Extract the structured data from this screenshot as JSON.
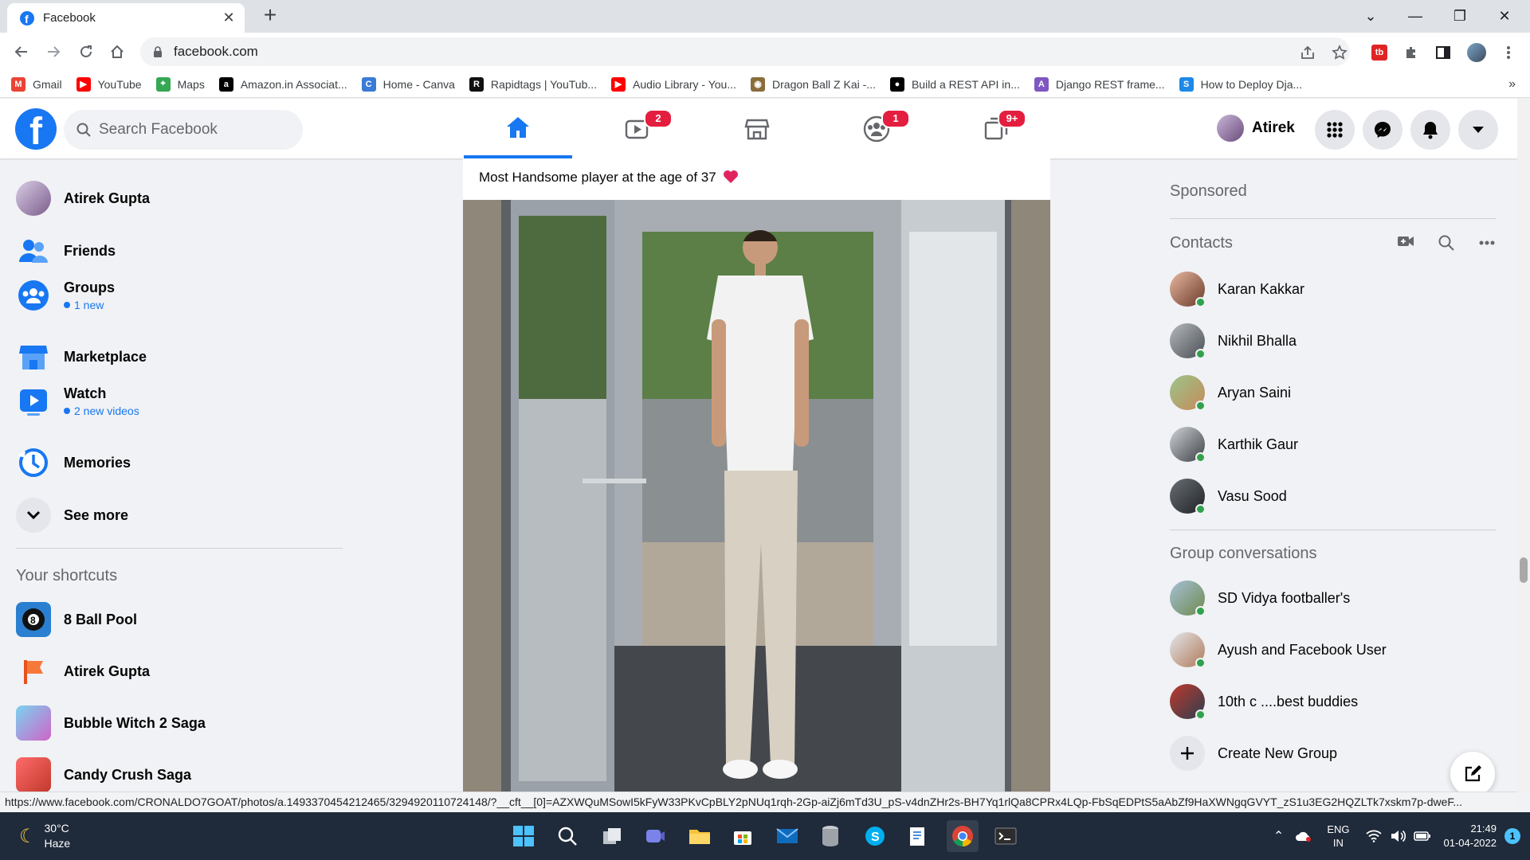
{
  "browser": {
    "tab_title": "Facebook",
    "url": "facebook.com",
    "bookmarks": [
      {
        "label": "Gmail",
        "icon": "gmail-icon",
        "color": "#ea4335",
        "glyph": "M"
      },
      {
        "label": "YouTube",
        "icon": "youtube-icon",
        "color": "#ff0000",
        "glyph": "▶"
      },
      {
        "label": "Maps",
        "icon": "maps-icon",
        "color": "#34a853",
        "glyph": "⌖"
      },
      {
        "label": "Amazon.in Associat...",
        "icon": "amazon-icon",
        "color": "#000000",
        "glyph": "a"
      },
      {
        "label": "Home - Canva",
        "icon": "canva-icon",
        "color": "#3a7bd5",
        "glyph": "C"
      },
      {
        "label": "Rapidtags | YouTub...",
        "icon": "rapidtags-icon",
        "color": "#111111",
        "glyph": "R"
      },
      {
        "label": "Audio Library - You...",
        "icon": "youtube-icon",
        "color": "#ff0000",
        "glyph": "▶"
      },
      {
        "label": "Dragon Ball Z Kai -...",
        "icon": "dragonball-icon",
        "color": "#8a6d3b",
        "glyph": "◉"
      },
      {
        "label": "Build a REST API in...",
        "icon": "medium-icon",
        "color": "#000000",
        "glyph": "●"
      },
      {
        "label": "Django REST frame...",
        "icon": "django-icon",
        "color": "#7e57c2",
        "glyph": "A"
      },
      {
        "label": "How to Deploy Dja...",
        "icon": "s-icon",
        "color": "#1e88e5",
        "glyph": "S"
      }
    ],
    "more_bookmarks": "»"
  },
  "header": {
    "search_placeholder": "Search Facebook",
    "profile_name": "Atirek",
    "badges": {
      "watch": "2",
      "groups": "1",
      "gaming": "9+"
    }
  },
  "left": {
    "items": [
      {
        "label": "Atirek Gupta"
      },
      {
        "label": "Friends"
      },
      {
        "label": "Groups",
        "sub": "1 new"
      },
      {
        "label": "Marketplace"
      },
      {
        "label": "Watch",
        "sub": "2 new videos"
      },
      {
        "label": "Memories"
      },
      {
        "label": "See more"
      }
    ],
    "shortcuts_heading": "Your shortcuts",
    "shortcuts": [
      {
        "label": "8 Ball Pool"
      },
      {
        "label": "Atirek Gupta"
      },
      {
        "label": "Bubble Witch 2 Saga"
      },
      {
        "label": "Candy Crush Saga"
      }
    ]
  },
  "post": {
    "text": "Most Handsome player at the age of 37"
  },
  "right": {
    "sponsored": "Sponsored",
    "contacts_heading": "Contacts",
    "contacts": [
      "Karan Kakkar",
      "Nikhil Bhalla",
      "Aryan Saini",
      "Karthik Gaur",
      "Vasu Sood"
    ],
    "groups_heading": "Group conversations",
    "groups": [
      "SD Vidya footballer's",
      "Ayush and Facebook User",
      "10th c ....best buddies"
    ],
    "create_group": "Create New Group"
  },
  "status_url": "https://www.facebook.com/CRONALDO7GOAT/photos/a.1493370454212465/3294920110724148/?__cft__[0]=AZXWQuMSowI5kFyW33PKvCpBLY2pNUq1rqh-2Gp-aiZj6mTd3U_pS-v4dnZHr2s-BH7Yq1rlQa8CPRx4LQp-FbSqEDPtS5aAbZf9HaXWNgqGVYT_zS1u3EG2HQZLTk7xskm7p-dweF...",
  "taskbar": {
    "temp": "30°C",
    "weather": "Haze",
    "lang": "ENG",
    "region": "IN",
    "time": "21:49",
    "date": "01-04-2022",
    "notif": "1"
  }
}
